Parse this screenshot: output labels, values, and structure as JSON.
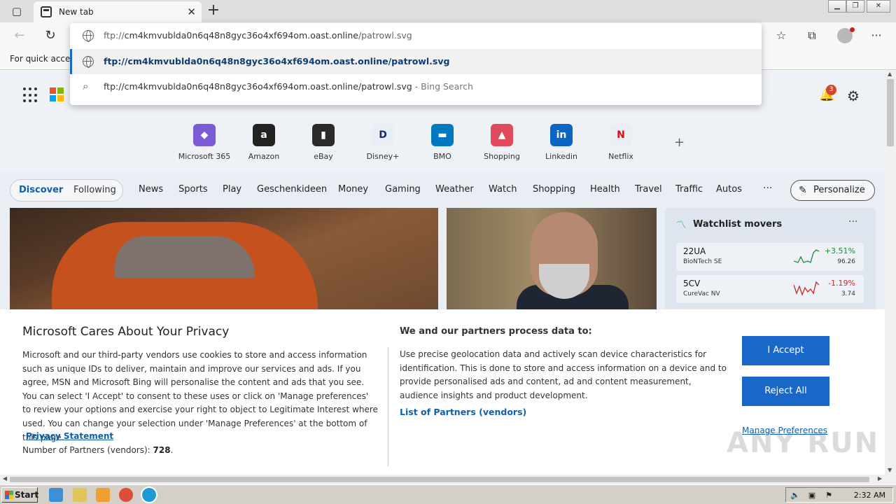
{
  "window": {
    "tab_title": "New tab",
    "close_label": "✕",
    "new_tab_label": "+"
  },
  "toolbar": {
    "back": "←",
    "reload": "↻",
    "favorites": "☆",
    "collections": "⧉",
    "menu": "···"
  },
  "favbar": {
    "text": "For quick access"
  },
  "omnibox": {
    "input_proto": "ftp://",
    "input_host": "cm4kmvublda0n6q48n8gyc36o4xf694om.oast.online",
    "input_path": "/patrowl.svg",
    "suggestion_url": "ftp://cm4kmvublda0n6q48n8gyc36o4xf694om.oast.online/patrowl.svg",
    "suggestion_search": "ftp://cm4kmvublda0n6q48n8gyc36o4xf694om.oast.online/patrowl.svg",
    "search_hint": " - Bing Search"
  },
  "header": {
    "notification_count": "3"
  },
  "quicklinks": [
    {
      "label": "Microsoft 365",
      "icon": "microsoft365-icon",
      "color": "#7b5cd6",
      "glyph": "◆"
    },
    {
      "label": "Amazon",
      "icon": "amazon-icon",
      "color": "#222222",
      "glyph": "a"
    },
    {
      "label": "eBay",
      "icon": "ebay-icon",
      "color": "#2b2b2b",
      "glyph": "▮"
    },
    {
      "label": "Disney+",
      "icon": "disney-icon",
      "color": "#e9eef4",
      "glyph": "D"
    },
    {
      "label": "BMO",
      "icon": "bmo-icon",
      "color": "#0079c1",
      "glyph": "▬"
    },
    {
      "label": "Shopping",
      "icon": "shopping-icon",
      "color": "#e04a5b",
      "glyph": "▲"
    },
    {
      "label": "Linkedin",
      "icon": "linkedin-icon",
      "color": "#0a66c2",
      "glyph": "in"
    },
    {
      "label": "Netflix",
      "icon": "netflix-icon",
      "color": "#e9eef4",
      "glyph": "N"
    }
  ],
  "nav": {
    "discover": "Discover",
    "following": "Following",
    "links": [
      "News",
      "Sports",
      "Play",
      "Geschenkideen",
      "Money",
      "Gaming",
      "Weather",
      "Watch",
      "Shopping",
      "Health",
      "Travel",
      "Traffic",
      "Autos"
    ],
    "more": "···",
    "personalize": "Personalize"
  },
  "watchlist": {
    "title": "Watchlist movers",
    "more": "···",
    "stocks": [
      {
        "symbol": "22UA",
        "name": "BioNTech SE",
        "change": "+3.51%",
        "price": "96.26",
        "color": "#1f8a3a"
      },
      {
        "symbol": "5CV",
        "name": "CureVac NV",
        "change": "-1.19%",
        "price": "3.74",
        "color": "#c42b2b"
      }
    ]
  },
  "privacy": {
    "title": "Microsoft Cares About Your Privacy",
    "body": "Microsoft and our third-party vendors use cookies to store and access information such as unique IDs to deliver, maintain and improve our services and ads. If you agree, MSN and Microsoft Bing will personalise the content and ads that you see. You can select 'I Accept' to consent to these uses or click on 'Manage preferences' to review your options and exercise your right to object to Legitimate Interest where used.  You can change your selection under 'Manage Preferences' at the bottom of this page.",
    "statement_link": "Privacy Statement",
    "partners_label": "Number of Partners (vendors): ",
    "partners_count": "728",
    "heading2": "We and our partners process data to:",
    "body2": "Use precise geolocation data and actively scan device characteristics for identification. This is done to store and access information on a device and to provide personalised ads and content, ad and content measurement, audience insights and product development.",
    "vendors_link": "List of Partners (vendors)",
    "accept": "I Accept",
    "reject": "Reject All",
    "manage": "Manage Preferences"
  },
  "watermark": "ANY RUN",
  "taskbar": {
    "start": "Start",
    "time": "2:32 AM"
  },
  "colors": {
    "accent": "#1967c8",
    "link": "#0f5fab"
  }
}
